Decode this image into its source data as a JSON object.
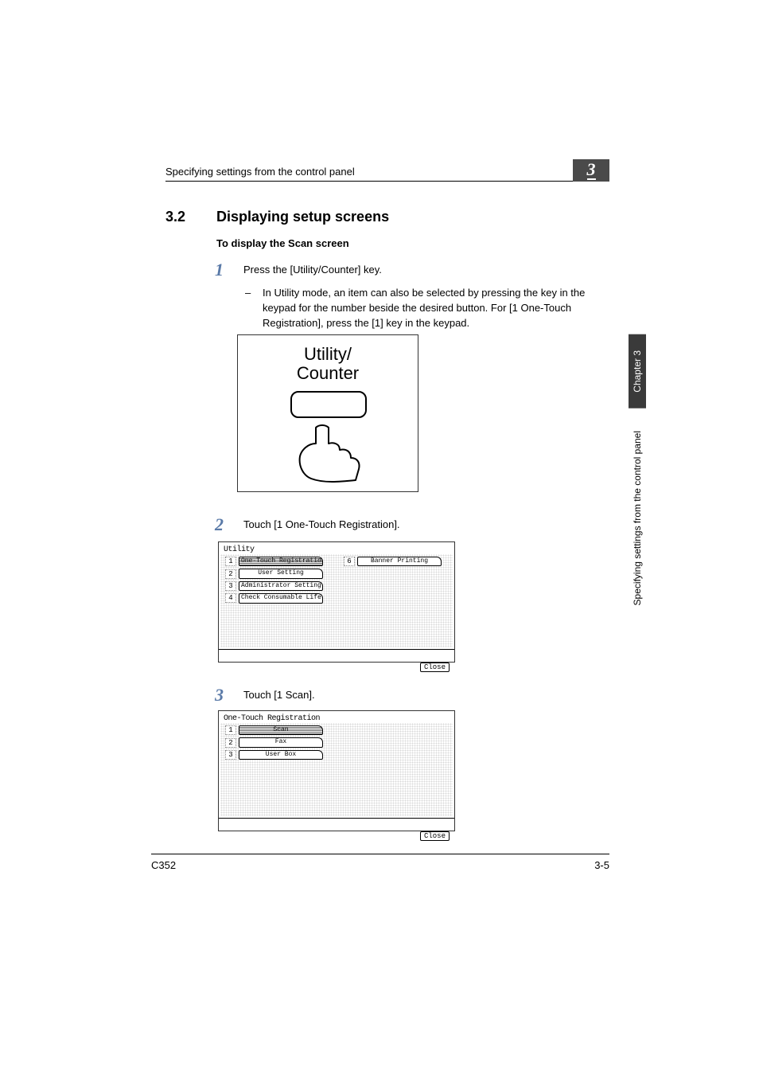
{
  "header": {
    "title": "Specifying settings from the control panel",
    "chapter_number": "3"
  },
  "section": {
    "number": "3.2",
    "title": "Displaying setup screens"
  },
  "sub_heading": "To display the Scan screen",
  "steps": {
    "s1": {
      "num": "1",
      "text": "Press the [Utility/Counter] key.",
      "note_dash": "–",
      "note": "In Utility mode, an item can also be selected by pressing the key in the keypad for the number beside the desired button. For [1 One-Touch Registration], press the [1] key in the keypad."
    },
    "s2": {
      "num": "2",
      "text": "Touch [1 One-Touch Registration]."
    },
    "s3": {
      "num": "3",
      "text": "Touch [1 Scan]."
    }
  },
  "frame1": {
    "label_top": "Utility/",
    "label_bottom": "Counter"
  },
  "panel2": {
    "title": "Utility",
    "items": [
      {
        "n": "1",
        "label": "One-Touch\nRegistration",
        "hatched": true
      },
      {
        "n": "2",
        "label": "User Setting"
      },
      {
        "n": "3",
        "label": "Administrator\nSetting"
      },
      {
        "n": "4",
        "label": "Check Consumable\nLife"
      }
    ],
    "right_item": {
      "n": "6",
      "label": "Banner Printing"
    },
    "close": "Close"
  },
  "panel3": {
    "title": "One-Touch Registration",
    "items": [
      {
        "n": "1",
        "label": "Scan",
        "hatched": true
      },
      {
        "n": "2",
        "label": "Fax"
      },
      {
        "n": "3",
        "label": "User Box"
      }
    ],
    "close": "Close"
  },
  "side_tab": {
    "chapter": "Chapter 3",
    "text": "Specifying settings from the control panel"
  },
  "footer": {
    "left": "C352",
    "right": "3-5"
  }
}
